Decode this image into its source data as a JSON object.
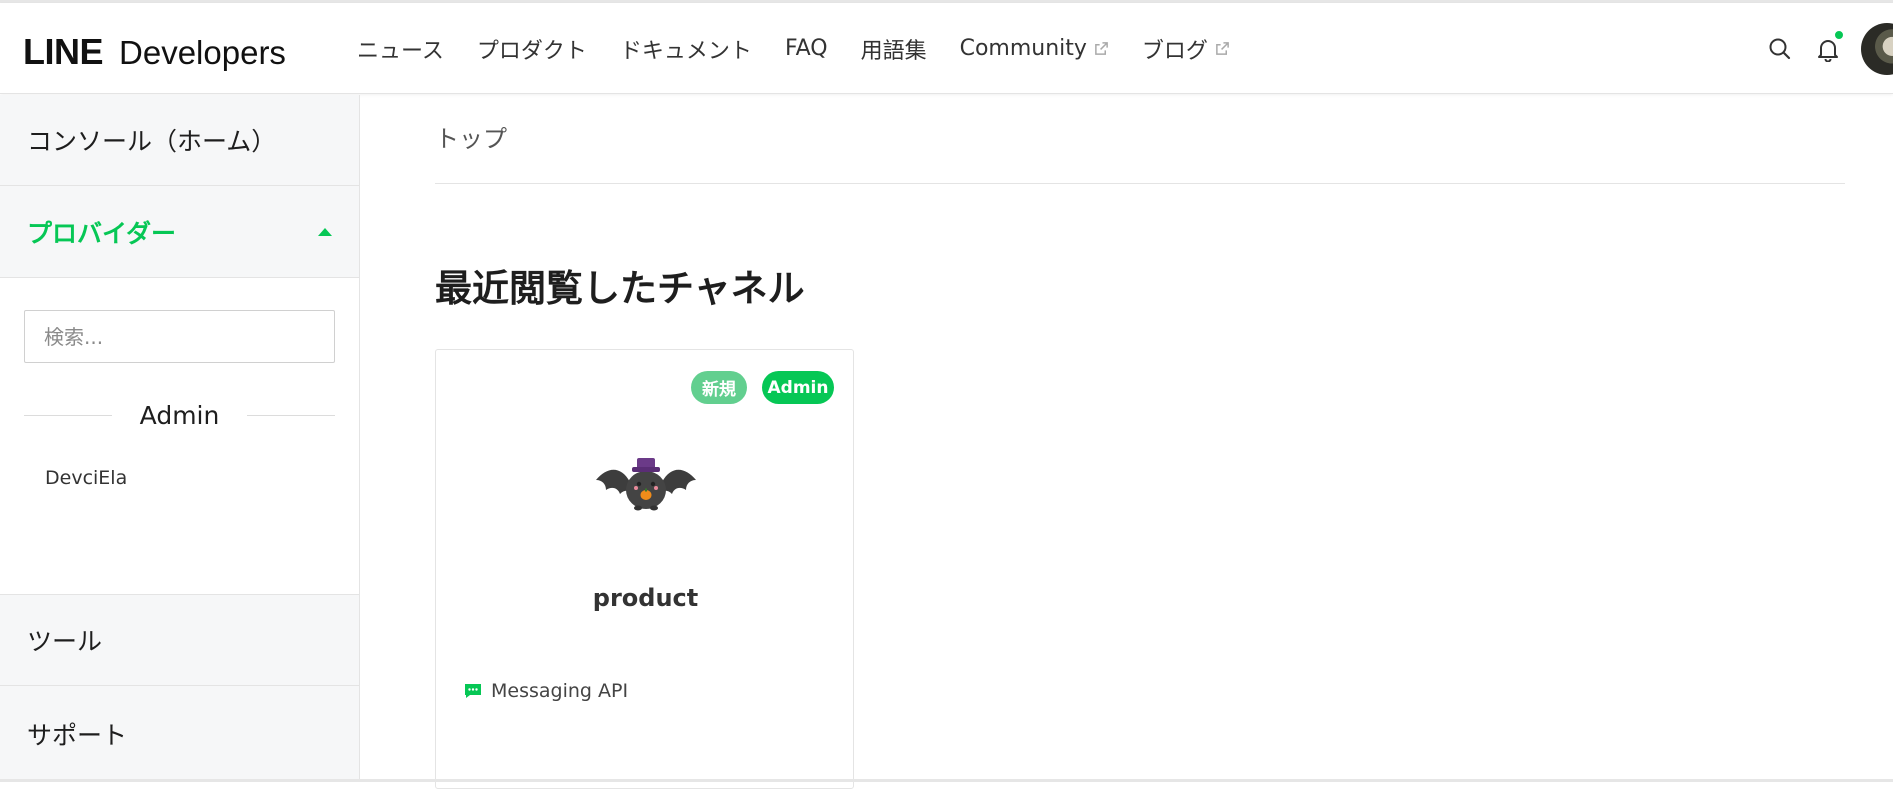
{
  "header": {
    "logo_line": "LINE",
    "logo_developers": "Developers",
    "nav": [
      {
        "label": "ニュース"
      },
      {
        "label": "プロダクト"
      },
      {
        "label": "ドキュメント"
      },
      {
        "label": "FAQ"
      },
      {
        "label": "用語集"
      },
      {
        "label": "Community"
      },
      {
        "label": "ブログ"
      }
    ],
    "icons": [
      "search-icon",
      "bell-icon",
      "external-link-icon"
    ],
    "notification_dot_color": "#06c755"
  },
  "sidebar": {
    "console_home": "コンソール（ホーム）",
    "providers": "プロバイダー",
    "search_placeholder": "検索...",
    "group_label": "Admin",
    "provider_items": [
      "DevciEla"
    ],
    "tools": "ツール",
    "support": "サポート"
  },
  "main": {
    "breadcrumb": "トップ",
    "section_title": "最近閲覧したチャネル",
    "channels": [
      {
        "badge_new": "新規",
        "badge_role": "Admin",
        "name": "product",
        "type": "Messaging API"
      }
    ]
  },
  "colors": {
    "accent": "#06c755",
    "badge_new": "#62cf8f",
    "sidebar_bg": "#f6f7f8"
  }
}
